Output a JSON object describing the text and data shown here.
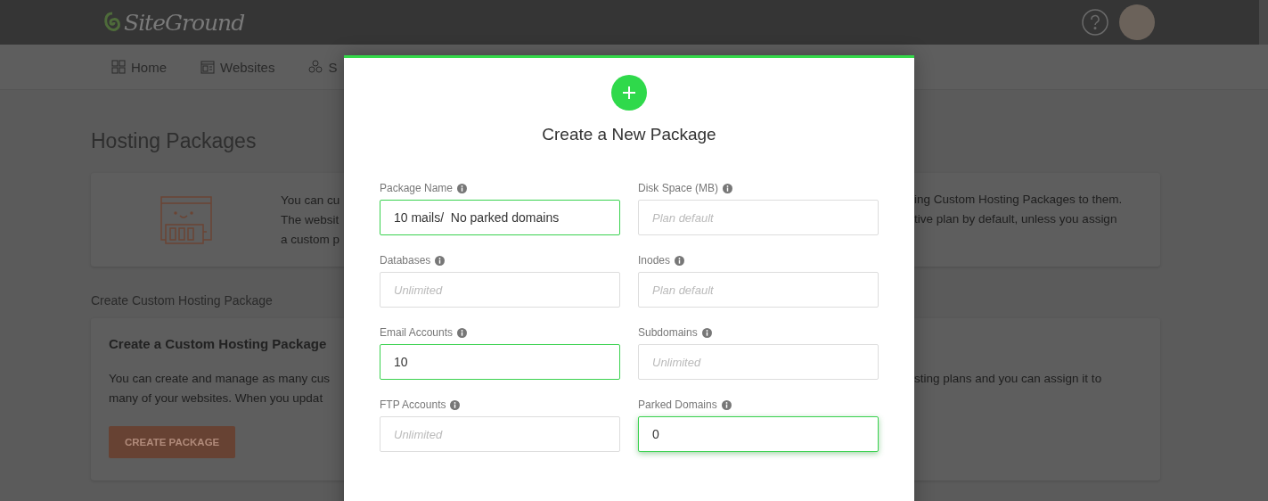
{
  "header": {
    "logo_text": "SiteGround"
  },
  "nav": {
    "items": [
      {
        "label": "Home"
      },
      {
        "label": "Websites"
      },
      {
        "label": "S"
      }
    ]
  },
  "page_title": "Hosting Packages",
  "info_card": {
    "left_lines": [
      "You can cu",
      "The websit",
      "a custom p"
    ],
    "right_lines": [
      "ing Custom Hosting Packages to them.",
      "tive plan by default, unless you assign"
    ]
  },
  "section_label": "Create Custom Hosting Package",
  "create_card": {
    "title": "Create a Custom Hosting Package",
    "left_lines": [
      "You can create and manage as many cus",
      "many of your websites. When you updat"
    ],
    "right_lines": [
      "sting plans and you can assign it to"
    ],
    "button": "CREATE PACKAGE"
  },
  "modal": {
    "title": "Create a New Package",
    "fields": [
      {
        "label": "Package Name",
        "value": "10 mails/  No parked domains",
        "valid": true,
        "focused": false
      },
      {
        "label": "Disk Space (MB)",
        "placeholder": "Plan default",
        "valid": false,
        "focused": false
      },
      {
        "label": "Databases",
        "placeholder": "Unlimited",
        "valid": false,
        "focused": false
      },
      {
        "label": "Inodes",
        "placeholder": "Plan default",
        "valid": false,
        "focused": false
      },
      {
        "label": "Email Accounts",
        "value": "10",
        "valid": true,
        "focused": false
      },
      {
        "label": "Subdomains",
        "placeholder": "Unlimited",
        "valid": false,
        "focused": false
      },
      {
        "label": "FTP Accounts",
        "placeholder": "Unlimited",
        "valid": false,
        "focused": false
      },
      {
        "label": "Parked Domains",
        "value": "0",
        "valid": true,
        "focused": true
      }
    ]
  }
}
